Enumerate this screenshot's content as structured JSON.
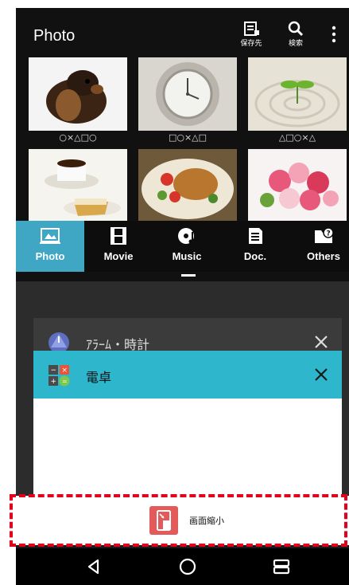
{
  "header": {
    "title": "Photo",
    "save_label": "保存先",
    "search_label": "検索"
  },
  "photos": [
    {
      "caption": "○×△□○",
      "subject": "dog"
    },
    {
      "caption": "□○×△□",
      "subject": "clock"
    },
    {
      "caption": "△□○×△",
      "subject": "sprout"
    },
    {
      "caption": "",
      "subject": "coffee"
    },
    {
      "caption": "",
      "subject": "food"
    },
    {
      "caption": "",
      "subject": "flowers"
    }
  ],
  "tabs": [
    {
      "label": "Photo",
      "icon": "photo-icon",
      "active": true
    },
    {
      "label": "Movie",
      "icon": "film-icon",
      "active": false
    },
    {
      "label": "Music",
      "icon": "music-disc-icon",
      "active": false
    },
    {
      "label": "Doc.",
      "icon": "document-icon",
      "active": false
    },
    {
      "label": "Others",
      "icon": "folder-question-icon",
      "active": false
    }
  ],
  "recent_apps": [
    {
      "title": "ｱﾗｰﾑ・時計",
      "icon": "clock-app-icon"
    },
    {
      "title": "電卓",
      "icon": "calculator-app-icon"
    }
  ],
  "shrink": {
    "label": "画面縮小"
  },
  "colors": {
    "accent": "#3fa6c4",
    "calc_header": "#2db6cc",
    "shrink_button": "#e35a5a",
    "highlight": "#e3001b"
  }
}
